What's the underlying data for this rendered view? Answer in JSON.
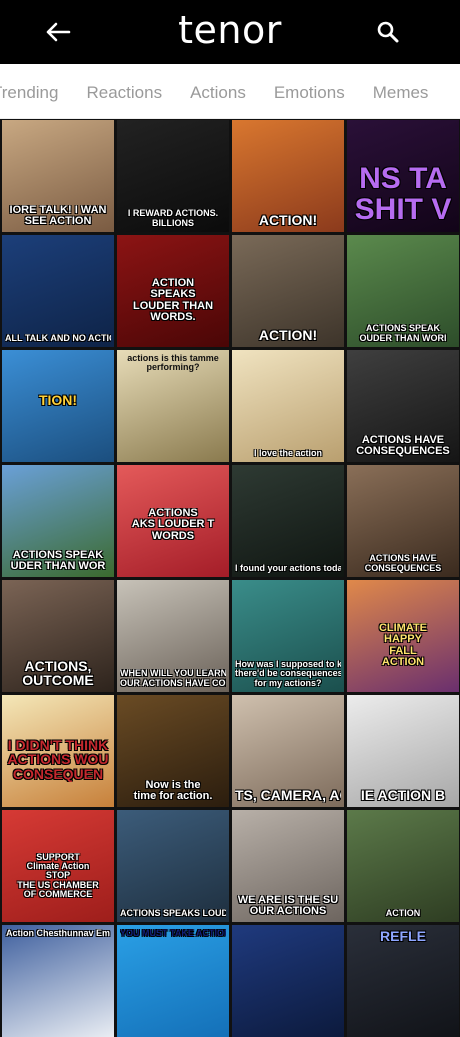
{
  "header": {
    "title": "tenor"
  },
  "icons": {
    "back": "back-arrow-icon",
    "search": "search-icon"
  },
  "tabs": [
    "Trending",
    "Reactions",
    "Actions",
    "Emotions",
    "Memes"
  ],
  "tiles": [
    {
      "bg": "linear-gradient(160deg,#c8a882,#7a5b42)",
      "captions": [
        "IORE TALK! I WAN",
        "SEE ACTION"
      ],
      "pos": "bottom",
      "size": "med"
    },
    {
      "bg": "linear-gradient(160deg,#222,#0b0b0b)",
      "captions": [
        "I REWARD ACTIONS.",
        "BILLIONS"
      ],
      "pos": "bottom",
      "size": "small"
    },
    {
      "bg": "linear-gradient(160deg,#d9772f,#8b3a1c)",
      "captions": [
        "ACTION!"
      ],
      "pos": "bottom",
      "size": "big"
    },
    {
      "bg": "linear-gradient(160deg,#2a1038,#120418)",
      "captions": [
        "NS TA",
        "SHIT V"
      ],
      "pos": "mid",
      "size": "huge",
      "color": "#b66cf0"
    },
    {
      "bg": "linear-gradient(160deg,#1c3f7a,#0e2347)",
      "captions": [
        "ALL TALK AND NO ACTION"
      ],
      "pos": "bottom",
      "size": "small"
    },
    {
      "bg": "linear-gradient(160deg,#8c1414,#4a0606)",
      "captions": [
        "ACTION",
        "SPEAKS",
        "LOUDER THAN",
        "WORDS."
      ],
      "pos": "mid",
      "size": "med"
    },
    {
      "bg": "linear-gradient(160deg,#7a6a58,#3d342a)",
      "captions": [
        "ACTION!"
      ],
      "pos": "bottom",
      "size": "big"
    },
    {
      "bg": "linear-gradient(160deg,#5b8a4d,#2d4d2a)",
      "captions": [
        "ACTIONS SPEAK",
        "OUDER THAN WORI"
      ],
      "pos": "bottom",
      "size": "small"
    },
    {
      "bg": "linear-gradient(160deg,#3b8fd6,#1b4e7e)",
      "captions": [
        "TION!"
      ],
      "pos": "mid",
      "size": "big",
      "color": "#ffd23a"
    },
    {
      "bg": "linear-gradient(160deg,#e7dcb8,#8a7a4e)",
      "captions": [
        "actions is this tamme",
        "performing?"
      ],
      "pos": "topcap",
      "size": "small",
      "dark": true
    },
    {
      "bg": "linear-gradient(160deg,#f0e3c0,#b99f6f)",
      "captions": [
        "I love the action"
      ],
      "pos": "bottom",
      "size": "small"
    },
    {
      "bg": "linear-gradient(160deg,#3f3f3f,#151515)",
      "captions": [
        "ACTIONS HAVE",
        "CONSEQUENCES"
      ],
      "pos": "bottom",
      "size": "med"
    },
    {
      "bg": "linear-gradient(160deg,#6aa0d8,#3b6a2e)",
      "captions": [
        "ACTIONS SPEAK",
        "UDER THAN WOR"
      ],
      "pos": "bottom",
      "size": "med"
    },
    {
      "bg": "linear-gradient(160deg,#e45a5a,#a41d28)",
      "captions": [
        "ACTIONS",
        "AKS LOUDER T",
        "WORDS"
      ],
      "pos": "mid",
      "size": "med"
    },
    {
      "bg": "linear-gradient(160deg,#2e3a33,#0f1511)",
      "captions": [
        "I found your actions today quite concerning"
      ],
      "pos": "bottom",
      "size": "small"
    },
    {
      "bg": "linear-gradient(160deg,#8a6f58,#3a2a1e)",
      "captions": [
        "ACTIONS HAVE",
        "CONSEQUENCES"
      ],
      "pos": "bottom",
      "size": "small"
    },
    {
      "bg": "linear-gradient(160deg,#7b6455,#2d231c)",
      "captions": [
        "ACTIONS,",
        "OUTCOME"
      ],
      "pos": "bottom",
      "size": "big"
    },
    {
      "bg": "linear-gradient(160deg,#c7c2b8,#6b6259)",
      "captions": [
        "WHEN WILL YOU LEARN THAT",
        "OUR ACTIONS HAVE CONSEQUENCES"
      ],
      "pos": "bottom",
      "size": "small"
    },
    {
      "bg": "linear-gradient(160deg,#3a8d8a,#1b4f4d)",
      "captions": [
        "How was I supposed to know",
        "there'd be consequences",
        "for my actions?"
      ],
      "pos": "bottom",
      "size": "small"
    },
    {
      "bg": "linear-gradient(160deg,#e0894a,#6a2f6e)",
      "captions": [
        "CLIMATE",
        "HAPPY",
        "FALL",
        "ACTION"
      ],
      "pos": "mid",
      "size": "med",
      "color": "#ffe36e"
    },
    {
      "bg": "linear-gradient(160deg,#f4e7b8,#c7803a)",
      "captions": [
        "I DIDN'T THINK",
        "ACTIONS WOU",
        "CONSEQUEN"
      ],
      "pos": "mid",
      "size": "big",
      "color": "#c4282e"
    },
    {
      "bg": "linear-gradient(160deg,#6a4b24,#2b1d0e)",
      "captions": [
        "Now is the",
        "time for action."
      ],
      "pos": "bottom",
      "size": "med"
    },
    {
      "bg": "linear-gradient(160deg,#cfc0ae,#7d6b5b)",
      "captions": [
        "TS, CAMERA, AC"
      ],
      "pos": "bottom",
      "size": "big"
    },
    {
      "bg": "linear-gradient(160deg,#ececec,#a7a7a7)",
      "captions": [
        "IE ACTION B"
      ],
      "pos": "bottom",
      "size": "big"
    },
    {
      "bg": "linear-gradient(160deg,#d63a35,#9e1e1b)",
      "captions": [
        "SUPPORT",
        "Climate Action",
        "STOP",
        "THE US CHAMBER",
        "OF COMMERCE"
      ],
      "pos": "mid",
      "size": "small"
    },
    {
      "bg": "linear-gradient(160deg,#3c5c7a,#1e2f3f)",
      "captions": [
        "ACTIONS SPEAKS LOUDER THAN"
      ],
      "pos": "bottom",
      "size": "small"
    },
    {
      "bg": "linear-gradient(160deg,#b8b0a8,#6d655f)",
      "captions": [
        "WE ARE IS THE SU",
        "OUR ACTIONS"
      ],
      "pos": "bottom",
      "size": "med"
    },
    {
      "bg": "linear-gradient(160deg,#5c7a4a,#2e3d22)",
      "captions": [
        "ACTION"
      ],
      "pos": "bottom",
      "size": "small"
    },
    {
      "bg": "linear-gradient(160deg,#3e5f9e,#e9edf3)",
      "captions": [
        "Action Chesthunnav Em"
      ],
      "pos": "topcap",
      "size": "small"
    },
    {
      "bg": "linear-gradient(160deg,#2aa0e6,#1470b8)",
      "captions": [
        "YOU MUST TAKE ACTION"
      ],
      "pos": "topcap",
      "size": "small",
      "color": "#11207a"
    },
    {
      "bg": "linear-gradient(160deg,#1f3a7e,#0c1a3d)",
      "captions": [
        ""
      ],
      "pos": "bottom",
      "size": "small"
    },
    {
      "bg": "linear-gradient(160deg,#2a2f3a,#111318)",
      "captions": [
        "REFLE"
      ],
      "pos": "topcap",
      "size": "big",
      "color": "#8ea6ff"
    }
  ]
}
